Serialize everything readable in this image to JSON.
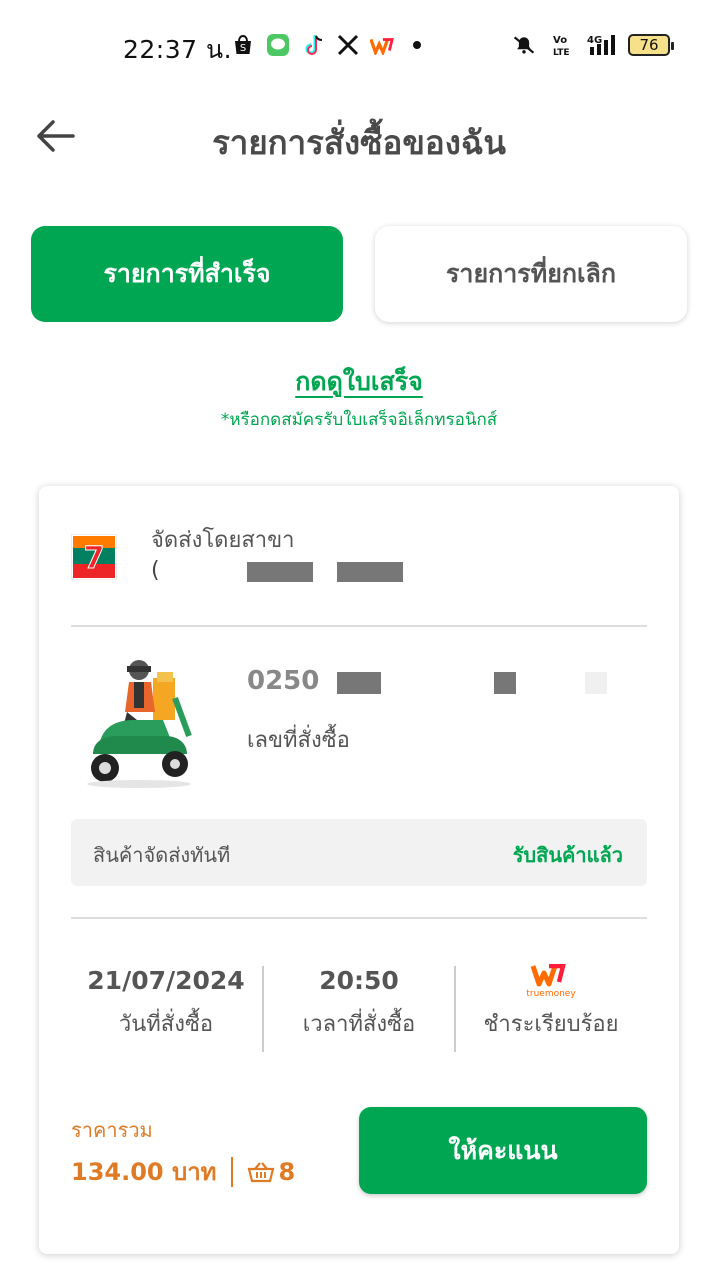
{
  "status_bar": {
    "time": "22:37 น.",
    "battery": "76",
    "icons": [
      "shopee-icon",
      "line-icon",
      "tiktok-icon",
      "x-icon",
      "truemoney-icon",
      "mute-icon",
      "volte-icon",
      "4g-signal-icon"
    ]
  },
  "header": {
    "title": "รายการสั่งซื้อของฉัน",
    "back_icon": "arrow-left-icon"
  },
  "tabs": [
    {
      "label": "รายการที่สำเร็จ",
      "active": true
    },
    {
      "label": "รายการที่ยกเลิก",
      "active": false
    }
  ],
  "receipt": {
    "link": "กดดูใบเสร็จ",
    "note": "*หรือกดสมัครรับใบเสร็จอิเล็กทรอนิกส์"
  },
  "order": {
    "store_logo": "7-eleven-logo",
    "branch_label": "จัดส่งโดยสาขา",
    "branch_name": "(",
    "order_number": "0250",
    "order_number_label": "เลขที่สั่งซื้อ",
    "delivery_type": "สินค้าจัดส่งทันที",
    "delivery_status": "รับสินค้าแล้ว",
    "date": "21/07/2024",
    "date_label": "วันที่สั่งซื้อ",
    "time": "20:50",
    "time_label": "เวลาที่สั่งซื้อ",
    "payment_brand": "truemoney",
    "payment_label": "ชำระเรียบร้อย",
    "total_label": "ราคารวม",
    "total_price": "134.00 บาท",
    "item_count": "8",
    "rate_button": "ให้คะแนน"
  },
  "colors": {
    "brand_green": "#00a651",
    "price_orange": "#e07b25"
  }
}
